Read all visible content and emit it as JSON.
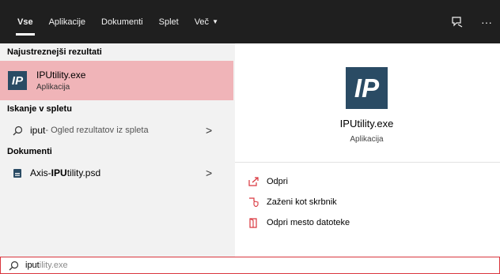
{
  "tabs": [
    {
      "label": "Vse",
      "active": true
    },
    {
      "label": "Aplikacije"
    },
    {
      "label": "Dokumenti"
    },
    {
      "label": "Splet"
    },
    {
      "label": "Več"
    }
  ],
  "top_icons": [
    "feedback-icon",
    "more-icon"
  ],
  "more_glyph": "···",
  "left": {
    "best_heading": "Najustreznejši rezultati",
    "best": {
      "logo": "IP",
      "name": "IPUtility.exe",
      "type": "Aplikacija"
    },
    "web_heading": "Iskanje v spletu",
    "web": {
      "query": "iput",
      "hint": " - Ogled rezultatov iz spleta",
      "chevron": ">"
    },
    "docs_heading": "Dokumenti",
    "doc": {
      "prefix": "Axis-",
      "bold": "IPU",
      "rest": "tility.psd",
      "chevron": ">"
    }
  },
  "right": {
    "logo": "IP",
    "name": "IPUtility.exe",
    "type": "Aplikacija",
    "actions": [
      {
        "label": "Odpri",
        "icon": "open-icon"
      },
      {
        "label": "Zaženi kot skrbnik",
        "icon": "admin-shield-icon"
      },
      {
        "label": "Odpri mesto datoteke",
        "icon": "file-location-icon"
      }
    ]
  },
  "search": {
    "typed": "iput",
    "ghost": "ility.exe"
  },
  "colors": {
    "accent": "#d9363e",
    "selection": "#f0b4b8",
    "logo_bg": "#2a4b64",
    "topbar": "#1f1f1f"
  }
}
